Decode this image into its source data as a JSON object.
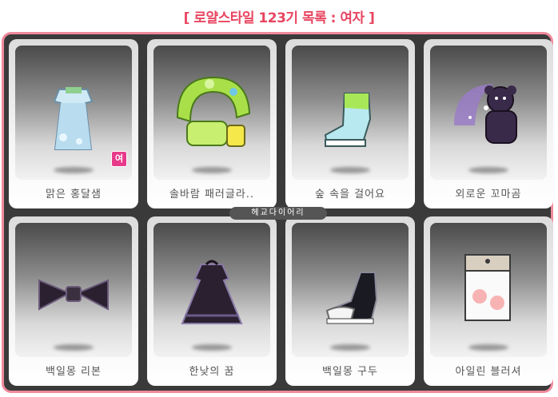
{
  "title": "[ 로얄스타일 123기 목록 : 여자 ]",
  "badge_label": "여",
  "tooltip": "헤교다이어리",
  "items": [
    {
      "label": "맑은 홍달샘",
      "icon": "white-dress-icon"
    },
    {
      "label": "솔바람 패러글라..",
      "icon": "green-pillow-scarf-icon"
    },
    {
      "label": "숲 속을 걸어요",
      "icon": "green-shoe-icon"
    },
    {
      "label": "외로운 꼬마곰",
      "icon": "purple-bear-icon"
    },
    {
      "label": "백일몽 리본",
      "icon": "black-ribbon-icon"
    },
    {
      "label": "한낮의 꿈",
      "icon": "black-dress-icon"
    },
    {
      "label": "백일몽 구두",
      "icon": "black-shoe-icon"
    },
    {
      "label": "아일린 블러셔",
      "icon": "blusher-icon"
    }
  ],
  "colors": {
    "title": "#e84560",
    "panel_border": "#f08a9c",
    "panel_bg": "#3a3a3a"
  }
}
